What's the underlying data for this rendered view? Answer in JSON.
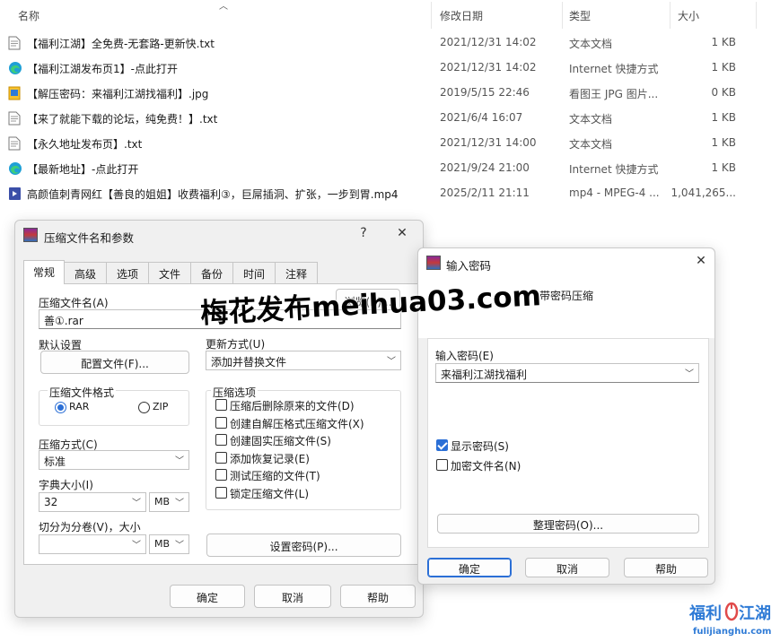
{
  "header": {
    "name": "名称",
    "modified": "修改日期",
    "type": "类型",
    "size": "大小"
  },
  "files": [
    {
      "name": "【福利江湖】全免费-无套路-更新快.txt",
      "date": "2021/12/31 14:02",
      "type": "文本文档",
      "size": "1 KB",
      "icon": "text-file-icon"
    },
    {
      "name": "【福利江湖发布页1】-点此打开",
      "date": "2021/12/31 14:02",
      "type": "Internet 快捷方式",
      "size": "1 KB",
      "icon": "edge-link-icon"
    },
    {
      "name": "【解压密码：来福利江湖找福利】.jpg",
      "date": "2019/5/15 22:46",
      "type": "看图王 JPG 图片...",
      "size": "0 KB",
      "icon": "image-file-icon"
    },
    {
      "name": "【来了就能下载的论坛，纯免费！】.txt",
      "date": "2021/6/4 16:07",
      "type": "文本文档",
      "size": "1 KB",
      "icon": "text-file-icon"
    },
    {
      "name": "【永久地址发布页】.txt",
      "date": "2021/12/31 14:00",
      "type": "文本文档",
      "size": "1 KB",
      "icon": "text-file-icon"
    },
    {
      "name": "【最新地址】-点此打开",
      "date": "2021/9/24 21:00",
      "type": "Internet 快捷方式",
      "size": "1 KB",
      "icon": "edge-link-icon"
    },
    {
      "name": "高颜值刺青网红【善良的姐姐】收费福利③，巨屌插洞、扩张，一步到胃.mp4",
      "date": "2025/2/11 21:11",
      "type": "mp4 - MPEG-4 ...",
      "size": "1,041,265...",
      "icon": "video-file-icon"
    }
  ],
  "archive_dialog": {
    "title": "压缩文件名和参数",
    "help": "?",
    "close": "✕",
    "tabs": [
      "常规",
      "高级",
      "选项",
      "文件",
      "备份",
      "时间",
      "注释"
    ],
    "filename_label": "压缩文件名(A)",
    "browse": "浏览(B)...",
    "filename_value": "善①.rar",
    "default_settings": "默认设置",
    "profiles": "配置文件(F)...",
    "update_mode_label": "更新方式(U)",
    "update_mode_value": "添加并替换文件",
    "format_label": "压缩文件格式",
    "format_rar": "RAR",
    "format_zip": "ZIP",
    "options_label": "压缩选项",
    "options": [
      {
        "label": "压缩后删除原来的文件(D)",
        "checked": false
      },
      {
        "label": "创建自解压格式压缩文件(X)",
        "checked": false
      },
      {
        "label": "创建固实压缩文件(S)",
        "checked": false
      },
      {
        "label": "添加恢复记录(E)",
        "checked": false
      },
      {
        "label": "测试压缩的文件(T)",
        "checked": false
      },
      {
        "label": "锁定压缩文件(L)",
        "checked": false
      }
    ],
    "method_label": "压缩方式(C)",
    "method_value": "标准",
    "dict_label": "字典大小(I)",
    "dict_value": "32",
    "dict_unit": "MB",
    "split_label": "切分为分卷(V)，大小",
    "split_value": "",
    "split_unit": "MB",
    "set_password": "设置密码(P)...",
    "ok": "确定",
    "cancel": "取消",
    "help_btn": "帮助"
  },
  "password_dialog": {
    "title": "输入密码",
    "close": "✕",
    "heading": "带密码压缩",
    "password_label": "输入密码(E)",
    "password_value": "来福利江湖找福利",
    "show_password": "显示密码(S)",
    "show_password_checked": true,
    "encrypt_names": "加密文件名(N)",
    "encrypt_names_checked": false,
    "organize": "整理密码(O)...",
    "ok": "确定",
    "cancel": "取消",
    "help_btn": "帮助"
  },
  "watermark": "梅花发布meihua03.com",
  "logo": {
    "text": "福利江湖",
    "url": "fulijianghu.com"
  }
}
